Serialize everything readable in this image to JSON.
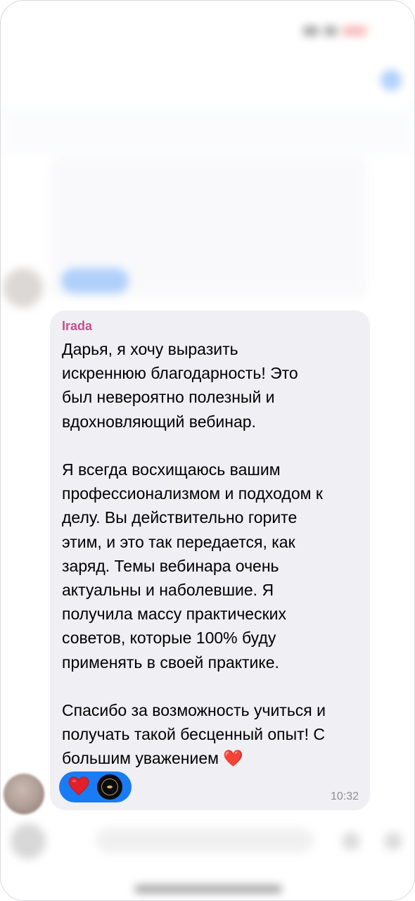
{
  "message": {
    "sender": "Irada",
    "lines": [
      "Дарья, я хочу выразить",
      "искреннюю благодарность! Это",
      "был невероятно полезный и",
      "вдохновляющий вебинар.",
      "",
      "Я всегда восхищаюсь вашим",
      "профессионализмом и подходом к",
      "делу. Вы действительно горите",
      "этим, и это так передается, как",
      "заряд. Темы вебинара очень",
      "актуальны и наболевшие. Я",
      "получила массу практических",
      "советов, которые 100% буду",
      "применять в своей практике.",
      "",
      "Спасибо за возможность учиться и",
      "получать такой бесценный опыт! С",
      "большим уважением"
    ],
    "inline_emoji": "❤️",
    "time": "10:32",
    "reactions": [
      {
        "icon": "red-heart-icon"
      },
      {
        "icon": "reactor-avatar"
      }
    ]
  },
  "colors": {
    "sender_name": "#c2528f",
    "bubble_bg": "#efeff4",
    "reaction_pill": "#1a7cf5",
    "heart": "#e0202a",
    "timestamp": "#8e8e93"
  }
}
